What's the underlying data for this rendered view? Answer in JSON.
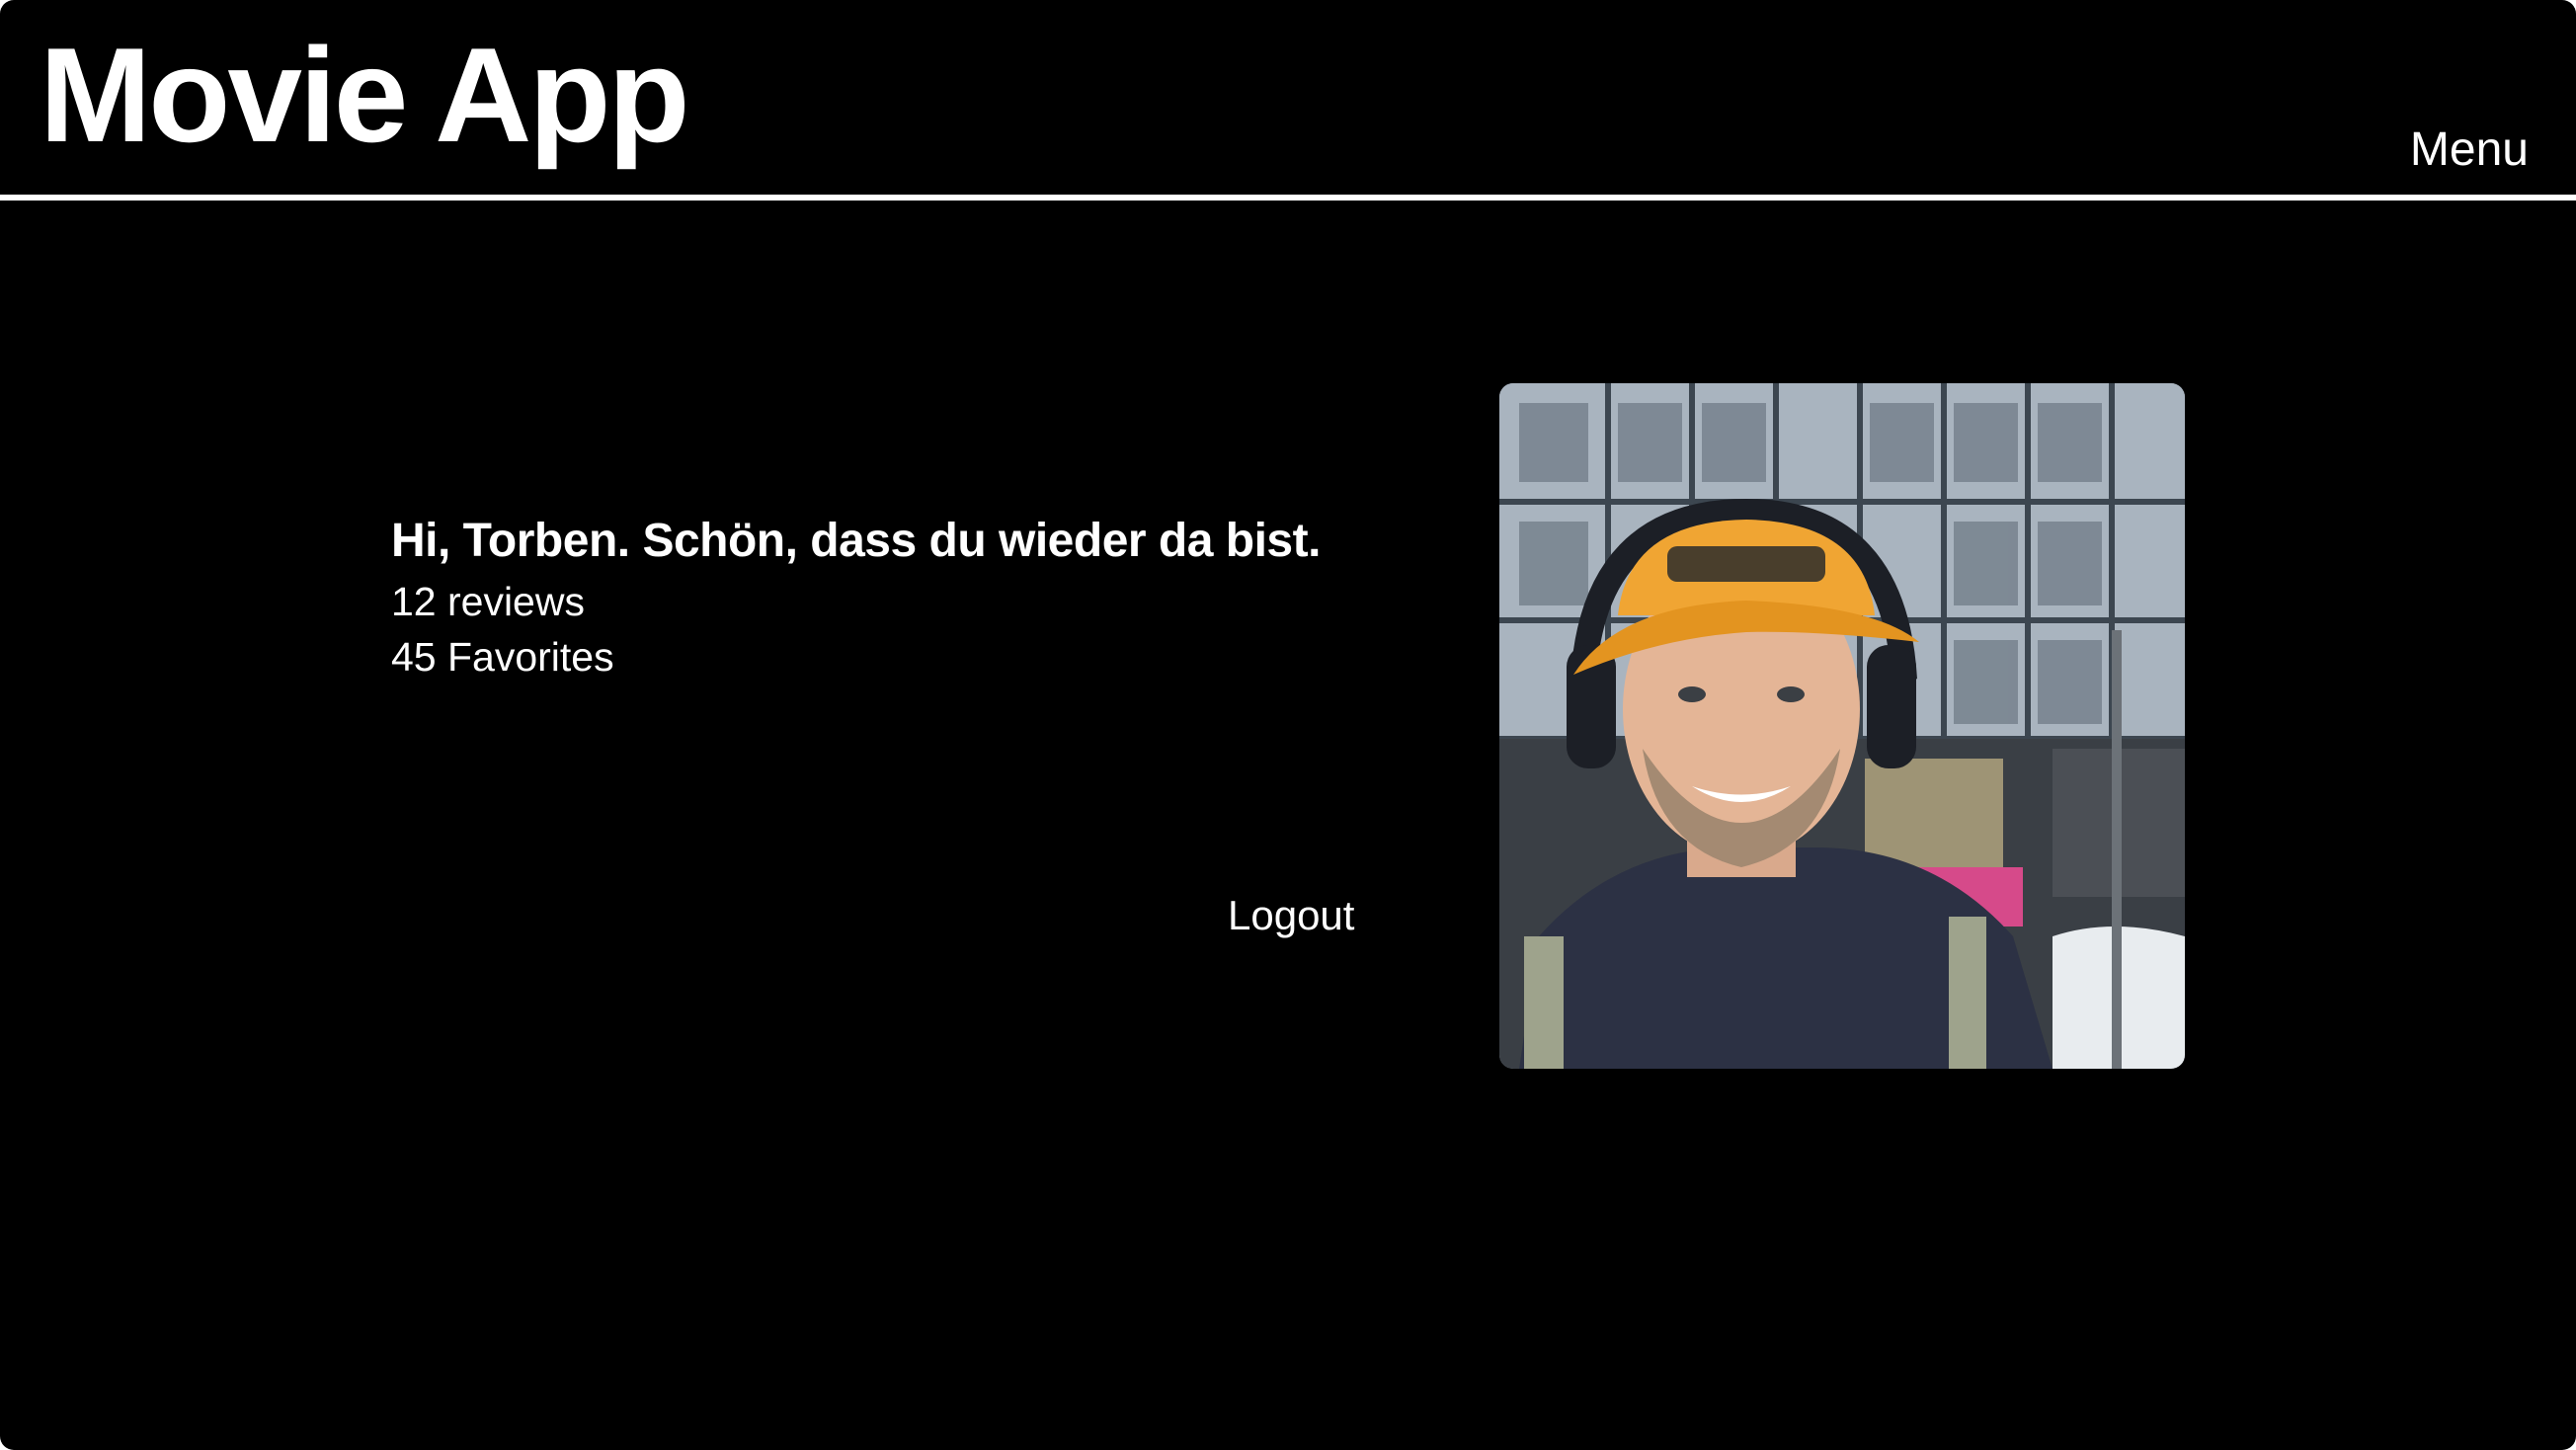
{
  "app": {
    "title": "Movie App"
  },
  "header": {
    "menu_label": "Menu"
  },
  "profile": {
    "greeting": "Hi, Torben. Schön, dass du wieder da bist.",
    "reviews_text": "12 reviews",
    "favorites_text": "45 Favorites",
    "logout_label": "Logout"
  },
  "colors": {
    "background": "#000000",
    "text": "#ffffff",
    "divider": "#ffffff",
    "cap": "#f0a533",
    "hoodie": "#2c3144"
  },
  "icons": {
    "avatar": "user-photo"
  }
}
